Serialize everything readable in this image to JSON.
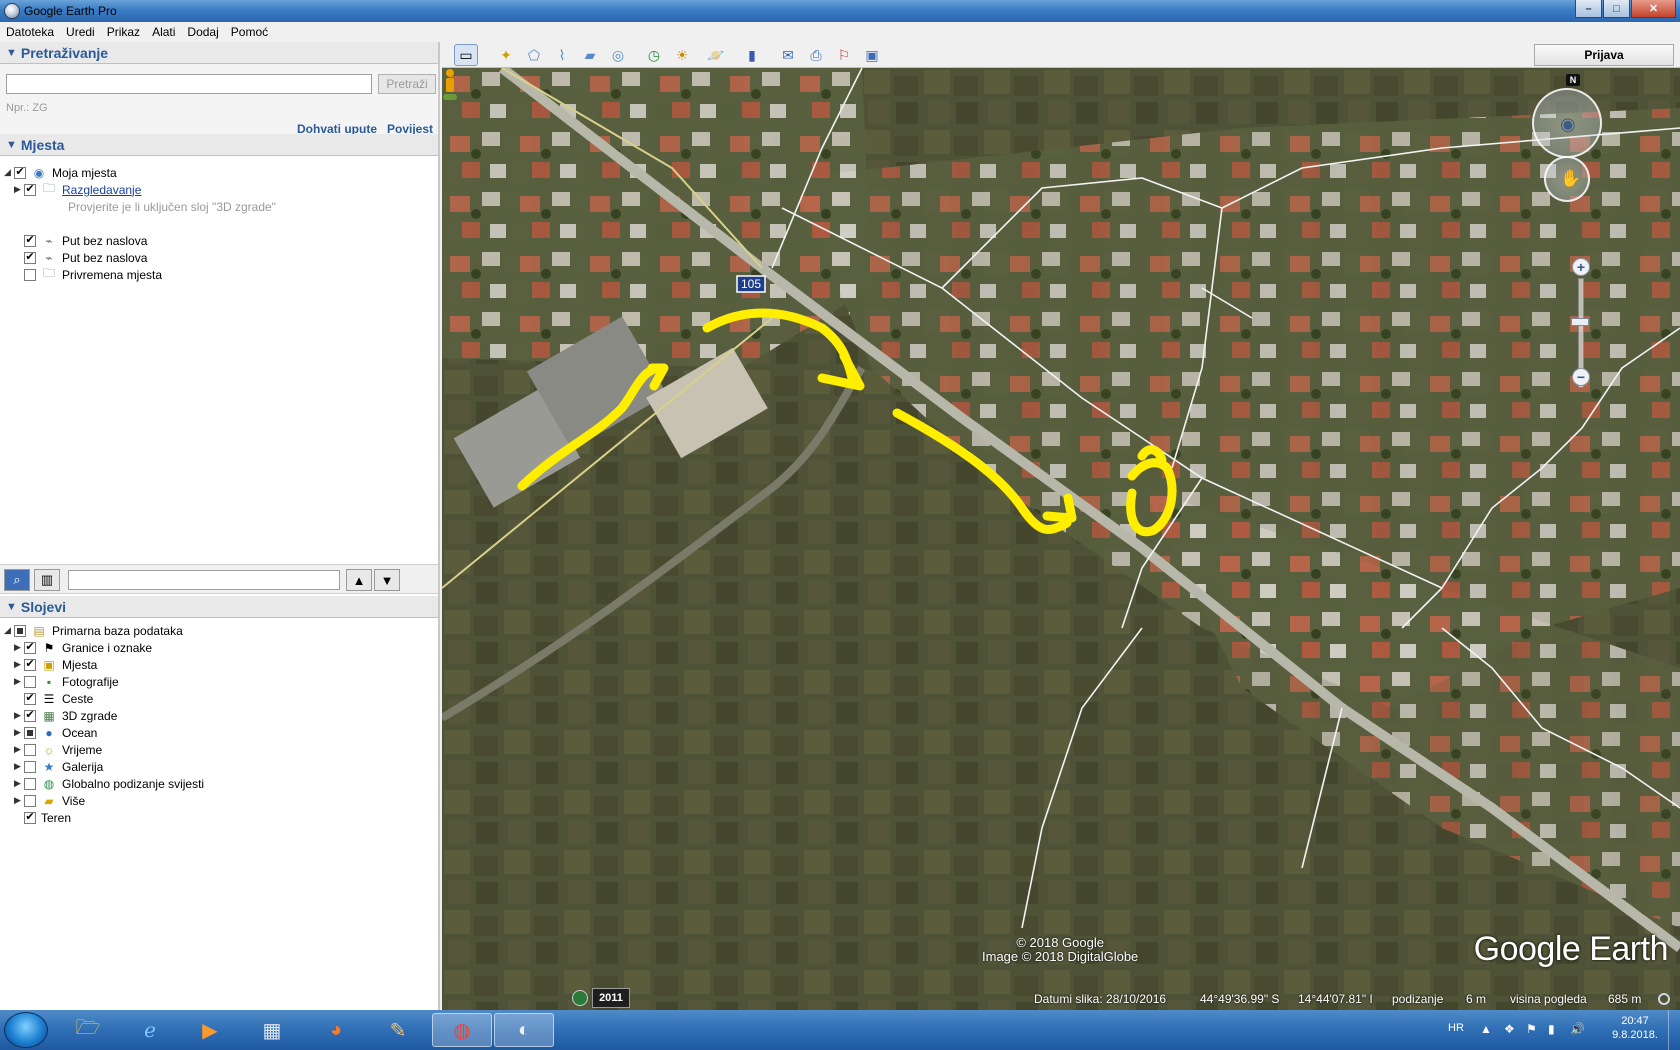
{
  "window": {
    "title": "Google Earth Pro",
    "min_label": "–",
    "max_label": "□",
    "close_label": "✕"
  },
  "menu": [
    "Datoteka",
    "Uredi",
    "Prikaz",
    "Alati",
    "Dodaj",
    "Pomoć"
  ],
  "search": {
    "header": "Pretraživanje",
    "placeholder": "",
    "button_label": "Pretraži",
    "hint": "Npr.: ZG",
    "directions_link": "Dohvati upute",
    "history_link": "Povijest"
  },
  "places": {
    "header": "Mjesta",
    "items": [
      {
        "label": "Moja mjesta",
        "checked": true
      },
      {
        "label": "Razgledavanje",
        "checked": true
      },
      {
        "label": "Provjerite je li uključen sloj \"3D zgrade\""
      },
      {
        "label": "Put bez naslova",
        "checked": true
      },
      {
        "label": "Put bez naslova",
        "checked": true
      },
      {
        "label": "Privremena mjesta",
        "checked": false
      }
    ]
  },
  "layers": {
    "header": "Slojevi",
    "items": [
      {
        "label": "Primarna baza podataka",
        "state": "partial"
      },
      {
        "label": "Granice i oznake",
        "state": "checked"
      },
      {
        "label": "Mjesta",
        "state": "checked"
      },
      {
        "label": "Fotografije",
        "state": "unchecked"
      },
      {
        "label": "Ceste",
        "state": "checked"
      },
      {
        "label": "3D zgrade",
        "state": "checked"
      },
      {
        "label": "Ocean",
        "state": "partial"
      },
      {
        "label": "Vrijeme",
        "state": "unchecked"
      },
      {
        "label": "Galerija",
        "state": "unchecked"
      },
      {
        "label": "Globalno podizanje svijesti",
        "state": "unchecked"
      },
      {
        "label": "Više",
        "state": "unchecked"
      },
      {
        "label": "Teren",
        "state": "checked"
      }
    ]
  },
  "toolbar": {
    "login_label": "Prijava"
  },
  "map": {
    "road_label": "105",
    "attribution_1": "© 2018 Google",
    "attribution_2": "Image © 2018 DigitalGlobe",
    "logo": "Google Earth",
    "compass_n": "N",
    "year": "2011",
    "status": {
      "date": "Datumi slika: 28/10/2016",
      "lat": "44°49'36.99\" S",
      "lon": "14°44'07.81\" I",
      "elevation_label": "podizanje",
      "elevation": "6 m",
      "eye_label": "visina pogleda",
      "eye": "685 m"
    }
  },
  "taskbar": {
    "lang": "HR",
    "time": "20:47",
    "date": "9.8.2018."
  },
  "colors": {
    "header_text": "#2c5a96",
    "annotation": "#ffee00",
    "road": "#f2f2f2"
  }
}
